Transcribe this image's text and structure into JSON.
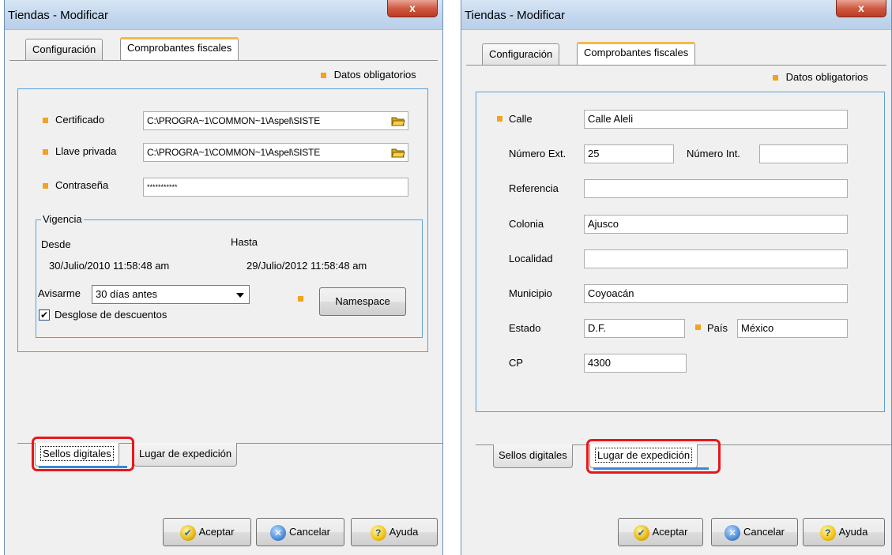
{
  "left": {
    "title": "Tiendas - Modificar",
    "close_label": "x",
    "tabs": [
      "Configuración",
      "Comprobantes fiscales"
    ],
    "required_note": "Datos obligatorios",
    "certificado": {
      "label": "Certificado",
      "value": "C:\\PROGRA~1\\COMMON~1\\Aspel\\SISTE"
    },
    "llave": {
      "label": "Llave privada",
      "value": "C:\\PROGRA~1\\COMMON~1\\Aspel\\SISTE"
    },
    "contrasena": {
      "label": "Contraseña",
      "value": "***********"
    },
    "vigencia": {
      "legend": "Vigencia",
      "desde_label": "Desde",
      "hasta_label": "Hasta",
      "desde_value": "30/Julio/2010 11:58:48 am",
      "hasta_value": "29/Julio/2012 11:58:48 am",
      "avisarme_label": "Avisarme",
      "avisarme_value": "30 días antes",
      "desglose_label": "Desglose de descuentos",
      "desglose_checked": true,
      "namespace_label": "Namespace"
    },
    "bottom_tabs": [
      "Sellos digitales",
      "Lugar de expedición"
    ],
    "buttons": {
      "ok": "Aceptar",
      "cancel": "Cancelar",
      "help": "Ayuda"
    }
  },
  "right": {
    "title": "Tiendas - Modificar",
    "close_label": "x",
    "tabs": [
      "Configuración",
      "Comprobantes fiscales"
    ],
    "required_note": "Datos obligatorios",
    "fields": {
      "calle": {
        "label": "Calle",
        "value": "Calle Aleli"
      },
      "num_ext": {
        "label": "Número Ext.",
        "value": "25"
      },
      "num_int": {
        "label": "Número Int.",
        "value": ""
      },
      "referencia": {
        "label": "Referencia",
        "value": ""
      },
      "colonia": {
        "label": "Colonia",
        "value": "Ajusco"
      },
      "localidad": {
        "label": "Localidad",
        "value": ""
      },
      "municipio": {
        "label": "Municipio",
        "value": "Coyoacán"
      },
      "estado": {
        "label": "Estado",
        "value": "D.F."
      },
      "pais": {
        "label": "País",
        "value": "México"
      },
      "cp": {
        "label": "CP",
        "value": "4300"
      }
    },
    "bottom_tabs": [
      "Sellos digitales",
      "Lugar de expedición"
    ],
    "buttons": {
      "ok": "Aceptar",
      "cancel": "Cancelar",
      "help": "Ayuda"
    }
  },
  "colors": {
    "required_marker": "#f4a21f",
    "highlight": "#e8171b",
    "panel_border": "#5aa0d8"
  }
}
